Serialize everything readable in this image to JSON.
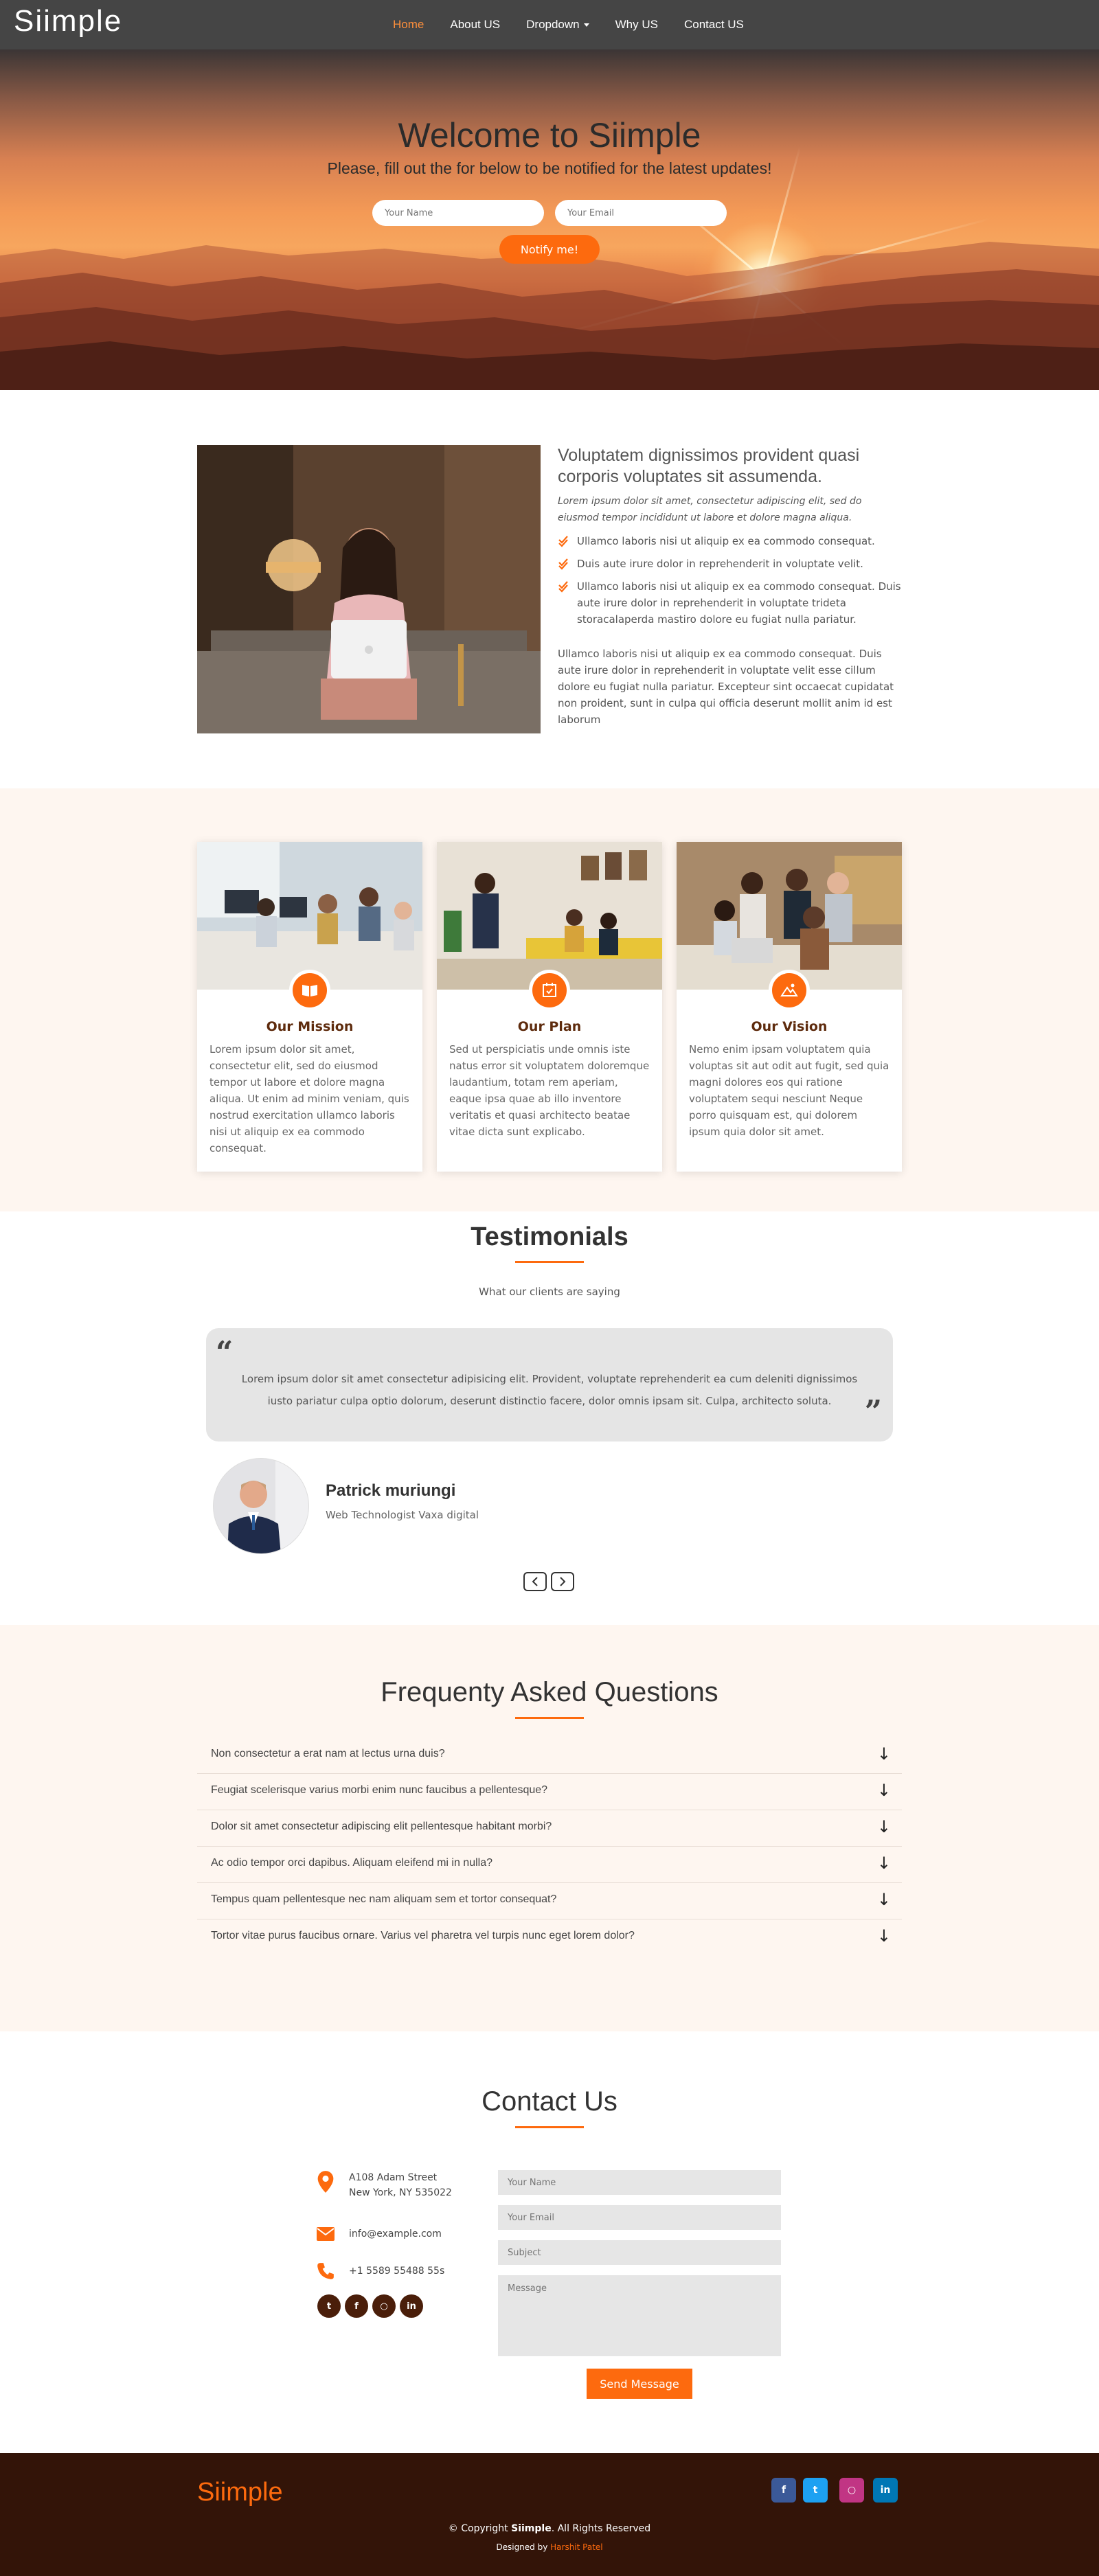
{
  "header": {
    "logo": "Siimple",
    "nav": [
      {
        "label": "Home",
        "active": true
      },
      {
        "label": "About US"
      },
      {
        "label": "Dropdown"
      },
      {
        "label": "Why US"
      },
      {
        "label": "Contact US"
      }
    ]
  },
  "hero": {
    "title": "Welcome to Siimple",
    "subtitle": "Please, fill out the for below to be notified for the latest updates!",
    "name_placeholder": "Your Name",
    "email_placeholder": "Your Email",
    "button": "Notify me!"
  },
  "about": {
    "title": "Voluptatem dignissimos provident quasi corporis voluptates sit assumenda.",
    "lead": "Lorem ipsum dolor sit amet, consectetur adipiscing elit, sed do eiusmod tempor incididunt ut labore et dolore magna aliqua.",
    "items": [
      "Ullamco laboris nisi ut aliquip ex ea commodo consequat.",
      "Duis aute irure dolor in reprehenderit in voluptate velit.",
      "Ullamco laboris nisi ut aliquip ex ea commodo consequat. Duis aute irure dolor in reprehenderit in voluptate trideta storacalaperda mastiro dolore eu fugiat nulla pariatur."
    ],
    "paragraph": "Ullamco laboris nisi ut aliquip ex ea commodo consequat. Duis aute irure dolor in reprehenderit in voluptate velit esse cillum dolore eu fugiat nulla pariatur. Excepteur sint occaecat cupidatat non proident, sunt in culpa qui officia deserunt mollit anim id est laborum"
  },
  "cards": [
    {
      "title": "Our Mission",
      "icon": "book-icon",
      "text": "Lorem ipsum dolor sit amet, consectetur elit, sed do eiusmod tempor ut labore et dolore magna aliqua. Ut enim ad minim veniam, quis nostrud exercitation ullamco laboris nisi ut aliquip ex ea commodo consequat."
    },
    {
      "title": "Our Plan",
      "icon": "calendar-check-icon",
      "text": "Sed ut perspiciatis unde omnis iste natus error sit voluptatem doloremque laudantium, totam rem aperiam, eaque ipsa quae ab illo inventore veritatis et quasi architecto beatae vitae dicta sunt explicabo."
    },
    {
      "title": "Our Vision",
      "icon": "image-icon",
      "text": "Nemo enim ipsam voluptatem quia voluptas sit aut odit aut fugit, sed quia magni dolores eos qui ratione voluptatem sequi nesciunt Neque porro quisquam est, qui dolorem ipsum quia dolor sit amet."
    }
  ],
  "testimonials": {
    "title": "Testimonials",
    "subtitle": "What our clients are saying",
    "quote": "Lorem ipsum dolor sit amet consectetur adipisicing elit. Provident, voluptate reprehenderit ea cum deleniti dignissimos iusto pariatur culpa optio dolorum, deserunt distinctio facere, dolor omnis ipsam sit. Culpa, architecto soluta.",
    "name": "Patrick muriungi",
    "role": "Web Technologist Vaxa digital"
  },
  "faq": {
    "title": "Frequenty Asked Questions",
    "items": [
      "Non consectetur a erat nam at lectus urna duis?",
      "Feugiat scelerisque varius morbi enim nunc faucibus a pellentesque?",
      "Dolor sit amet consectetur adipiscing elit pellentesque habitant morbi?",
      "Ac odio tempor orci dapibus. Aliquam eleifend mi in nulla?",
      "Tempus quam pellentesque nec nam aliquam sem et tortor consequat?",
      "Tortor vitae purus faucibus ornare. Varius vel pharetra vel turpis nunc eget lorem dolor?"
    ]
  },
  "contact": {
    "title": "Contact Us",
    "address_line1": "A108 Adam Street",
    "address_line2": "New York, NY 535022",
    "email": "info@example.com",
    "phone": "+1 5589 55488 55s",
    "socials": [
      "twitter-icon",
      "facebook-icon",
      "instagram-icon",
      "linkedin-icon"
    ],
    "form": {
      "name_placeholder": "Your Name",
      "email_placeholder": "Your Email",
      "subject_placeholder": "Subject",
      "message_placeholder": "Message",
      "button": "Send Message"
    }
  },
  "footer": {
    "logo": "Siimple",
    "copy_prefix": "© Copyright ",
    "copy_brand": "Siimple",
    "copy_suffix": ". All Rights Reserved",
    "designed_prefix": "Designed by ",
    "designer": "Harshit Patel",
    "socials": [
      {
        "icon": "facebook-icon",
        "color": "#3b5998"
      },
      {
        "icon": "twitter-icon",
        "color": "#1da1f2"
      },
      {
        "icon": "instagram-icon",
        "color": "#c13584"
      },
      {
        "icon": "linkedin-icon",
        "color": "#0077b5"
      }
    ]
  },
  "colors": {
    "accent": "#fd6a0e",
    "brown": "#5e2b0d",
    "footer": "#331408"
  }
}
